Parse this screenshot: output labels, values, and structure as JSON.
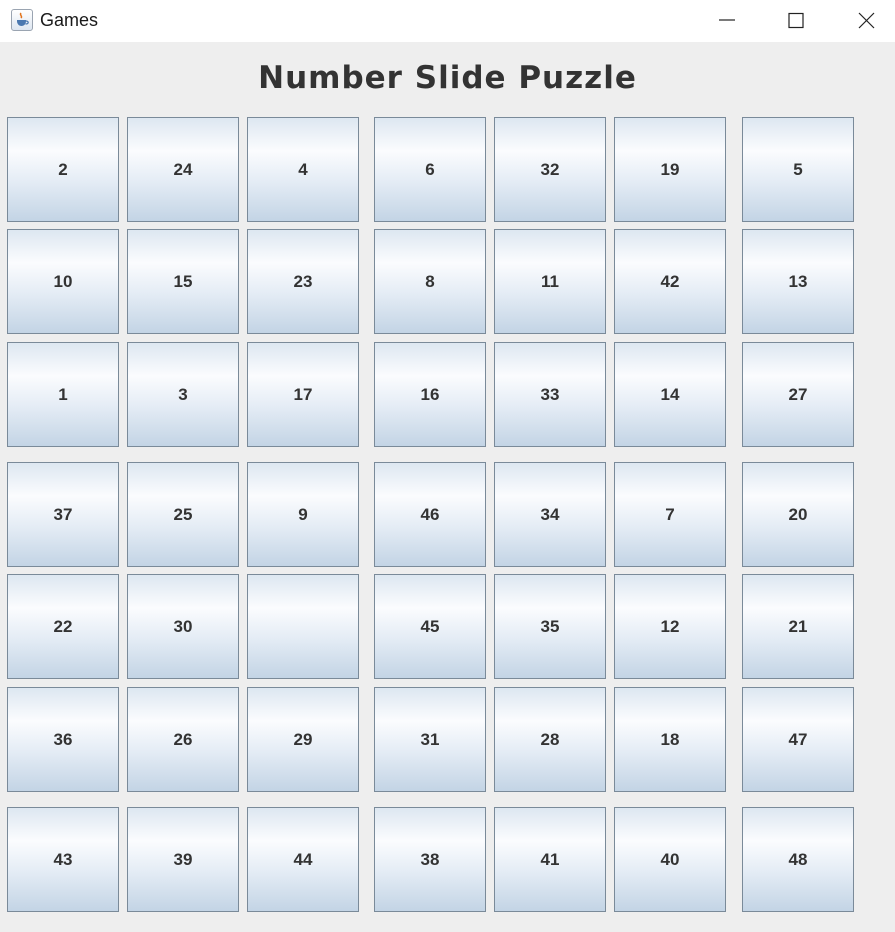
{
  "window": {
    "title": "Games",
    "icon": "java-cup-icon",
    "controls": [
      "minimize-icon",
      "maximize-icon",
      "close-icon"
    ]
  },
  "heading": "Number Slide Puzzle",
  "grid": {
    "rows": 7,
    "cols": 7,
    "tiles": [
      [
        "2",
        "24",
        "4",
        "6",
        "32",
        "19",
        "5"
      ],
      [
        "10",
        "15",
        "23",
        "8",
        "11",
        "42",
        "13"
      ],
      [
        "1",
        "3",
        "17",
        "16",
        "33",
        "14",
        "27"
      ],
      [
        "37",
        "25",
        "9",
        "46",
        "34",
        "7",
        "20"
      ],
      [
        "22",
        "30",
        "",
        "45",
        "35",
        "12",
        "21"
      ],
      [
        "36",
        "26",
        "29",
        "31",
        "28",
        "18",
        "47"
      ],
      [
        "43",
        "39",
        "44",
        "38",
        "41",
        "40",
        "48"
      ]
    ]
  }
}
